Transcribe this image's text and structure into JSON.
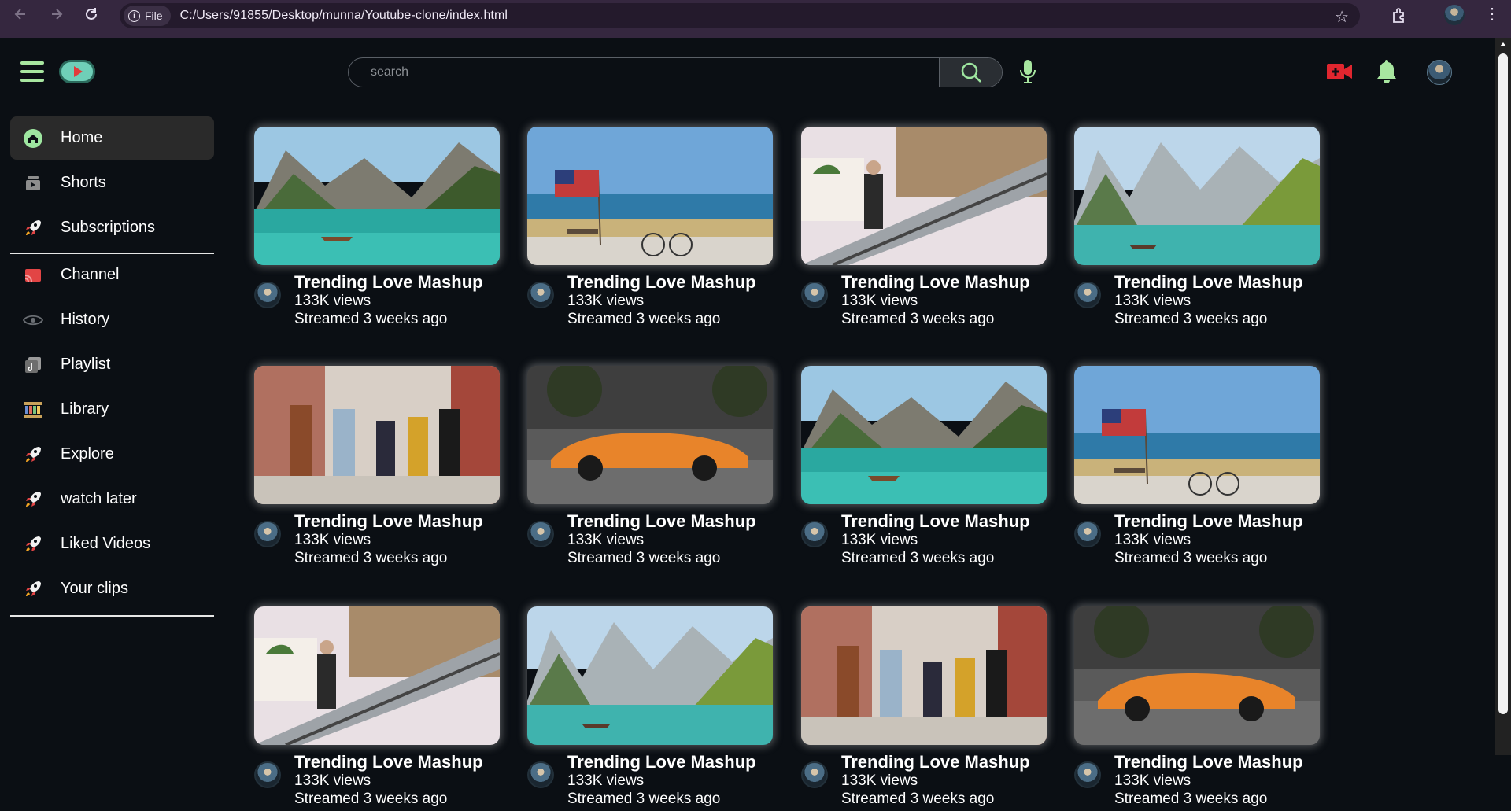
{
  "browser": {
    "file_chip": "File",
    "url": "C:/Users/91855/Desktop/munna/Youtube-clone/index.html"
  },
  "header": {
    "search_placeholder": "search"
  },
  "sidebar": {
    "items": [
      {
        "label": "Home",
        "icon": "home-icon",
        "active": true
      },
      {
        "label": "Shorts",
        "icon": "shorts-icon"
      },
      {
        "label": "Subscriptions",
        "icon": "rocket-icon"
      },
      {
        "label": "Channel",
        "icon": "channel-icon"
      },
      {
        "label": "History",
        "icon": "eye-icon"
      },
      {
        "label": "Playlist",
        "icon": "playlist-icon"
      },
      {
        "label": "Library",
        "icon": "library-icon"
      },
      {
        "label": "Explore",
        "icon": "rocket-icon"
      },
      {
        "label": "watch later",
        "icon": "rocket-icon"
      },
      {
        "label": "Liked Videos",
        "icon": "rocket-icon"
      },
      {
        "label": "Your clips",
        "icon": "rocket-icon"
      }
    ]
  },
  "videos": [
    {
      "title": "Trending Love Mashup",
      "views": "133K views",
      "time": "Streamed 3 weeks ago",
      "thumb": "lake-boat"
    },
    {
      "title": "Trending Love Mashup",
      "views": "133K views",
      "time": "Streamed 3 weeks ago",
      "thumb": "beach-flag"
    },
    {
      "title": "Trending Love Mashup",
      "views": "133K views",
      "time": "Streamed 3 weeks ago",
      "thumb": "escalator"
    },
    {
      "title": "Trending Love Mashup",
      "views": "133K views",
      "time": "Streamed 3 weeks ago",
      "thumb": "mountain-lake"
    },
    {
      "title": "Trending Love Mashup",
      "views": "133K views",
      "time": "Streamed 3 weeks ago",
      "thumb": "friends-walking"
    },
    {
      "title": "Trending Love Mashup",
      "views": "133K views",
      "time": "Streamed 3 weeks ago",
      "thumb": "orange-car"
    },
    {
      "title": "Trending Love Mashup",
      "views": "133K views",
      "time": "Streamed 3 weeks ago",
      "thumb": "lake-boat"
    },
    {
      "title": "Trending Love Mashup",
      "views": "133K views",
      "time": "Streamed 3 weeks ago",
      "thumb": "beach-flag"
    },
    {
      "title": "Trending Love Mashup",
      "views": "133K views",
      "time": "Streamed 3 weeks ago",
      "thumb": "escalator"
    },
    {
      "title": "Trending Love Mashup",
      "views": "133K views",
      "time": "Streamed 3 weeks ago",
      "thumb": "mountain-lake"
    },
    {
      "title": "Trending Love Mashup",
      "views": "133K views",
      "time": "Streamed 3 weeks ago",
      "thumb": "friends-walking"
    },
    {
      "title": "Trending Love Mashup",
      "views": "133K views",
      "time": "Streamed 3 weeks ago",
      "thumb": "orange-car"
    }
  ]
}
